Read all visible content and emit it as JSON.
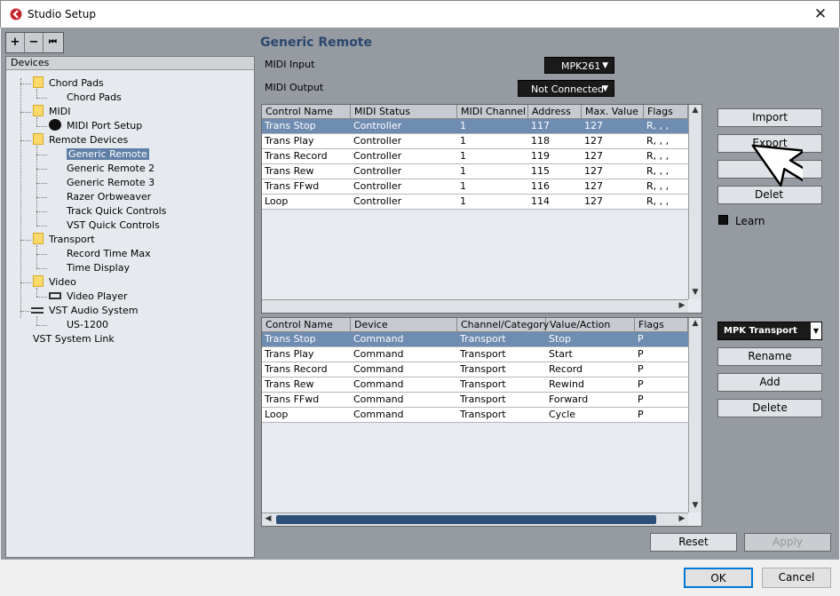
{
  "window": {
    "title": "Studio Setup",
    "close_glyph": "✕"
  },
  "toolbar": {
    "add": "+",
    "remove": "−",
    "reset": "⏮"
  },
  "tree": {
    "header": "Devices",
    "items": [
      {
        "label": "Chord Pads",
        "level": 1,
        "folder": true
      },
      {
        "label": "Chord Pads",
        "level": 2
      },
      {
        "label": "MIDI",
        "level": 1,
        "folder": true
      },
      {
        "label": "MIDI Port Setup",
        "level": 2,
        "icon": "midi-icon"
      },
      {
        "label": "Remote Devices",
        "level": 1,
        "folder": true
      },
      {
        "label": "Generic Remote",
        "level": 2,
        "selected": true
      },
      {
        "label": "Generic Remote 2",
        "level": 2
      },
      {
        "label": "Generic Remote 3",
        "level": 2
      },
      {
        "label": "Razer Orbweaver",
        "level": 2
      },
      {
        "label": "Track Quick Controls",
        "level": 2
      },
      {
        "label": "VST Quick Controls",
        "level": 2
      },
      {
        "label": "Transport",
        "level": 1,
        "folder": true
      },
      {
        "label": "Record Time Max",
        "level": 2
      },
      {
        "label": "Time Display",
        "level": 2
      },
      {
        "label": "Video",
        "level": 1,
        "folder": true
      },
      {
        "label": "Video Player",
        "level": 2,
        "icon": "video-icon"
      },
      {
        "label": "VST Audio System",
        "level": 1,
        "icon": "audio-icon"
      },
      {
        "label": "US-1200",
        "level": 2
      },
      {
        "label": "VST System Link",
        "level": 0
      }
    ]
  },
  "panel": {
    "title": "Generic Remote",
    "midi_input_label": "MIDI Input",
    "midi_input_value": "MPK261",
    "midi_output_label": "MIDI Output",
    "midi_output_value": "Not Connected",
    "dropdown_glyph": "▼"
  },
  "top_table": {
    "columns": [
      "Control Name",
      "MIDI Status",
      "MIDI Channel",
      "Address",
      "Max. Value",
      "Flags"
    ],
    "rows": [
      [
        "Trans Stop",
        "Controller",
        "1",
        "117",
        "127",
        "R, , ,"
      ],
      [
        "Trans Play",
        "Controller",
        "1",
        "118",
        "127",
        "R, , ,"
      ],
      [
        "Trans Record",
        "Controller",
        "1",
        "119",
        "127",
        "R, , ,"
      ],
      [
        "Trans Rew",
        "Controller",
        "1",
        "115",
        "127",
        "R, , ,"
      ],
      [
        "Trans FFwd",
        "Controller",
        "1",
        "116",
        "127",
        "R, , ,"
      ],
      [
        "Loop",
        "Controller",
        "1",
        "114",
        "127",
        "R, , ,"
      ]
    ]
  },
  "bottom_table": {
    "columns": [
      "Control Name",
      "Device",
      "Channel/Category",
      "Value/Action",
      "Flags"
    ],
    "rows": [
      [
        "Trans Stop",
        "Command",
        "Transport",
        "Stop",
        "P"
      ],
      [
        "Trans Play",
        "Command",
        "Transport",
        "Start",
        "P"
      ],
      [
        "Trans Record",
        "Command",
        "Transport",
        "Record",
        "P"
      ],
      [
        "Trans Rew",
        "Command",
        "Transport",
        "Rewind",
        "P"
      ],
      [
        "Trans FFwd",
        "Command",
        "Transport",
        "Forward",
        "P"
      ],
      [
        "Loop",
        "Command",
        "Transport",
        "Cycle",
        "P"
      ]
    ]
  },
  "side_buttons": {
    "import": "Import",
    "export": "Export",
    "add_partial": "",
    "delete_partial": "Delet",
    "learn": "Learn"
  },
  "preset": {
    "value": "MPK Transport",
    "rename": "Rename",
    "add": "Add",
    "delete": "Delete"
  },
  "apply_bar": {
    "reset": "Reset",
    "apply": "Apply"
  },
  "dialog": {
    "ok": "OK",
    "cancel": "Cancel"
  },
  "scroll": {
    "up": "▲",
    "down": "▼",
    "left": "◀",
    "right": "▶"
  },
  "colors": {
    "accent": "#2b466c",
    "selection": "#6f8cb1",
    "focus": "#0078d7"
  }
}
